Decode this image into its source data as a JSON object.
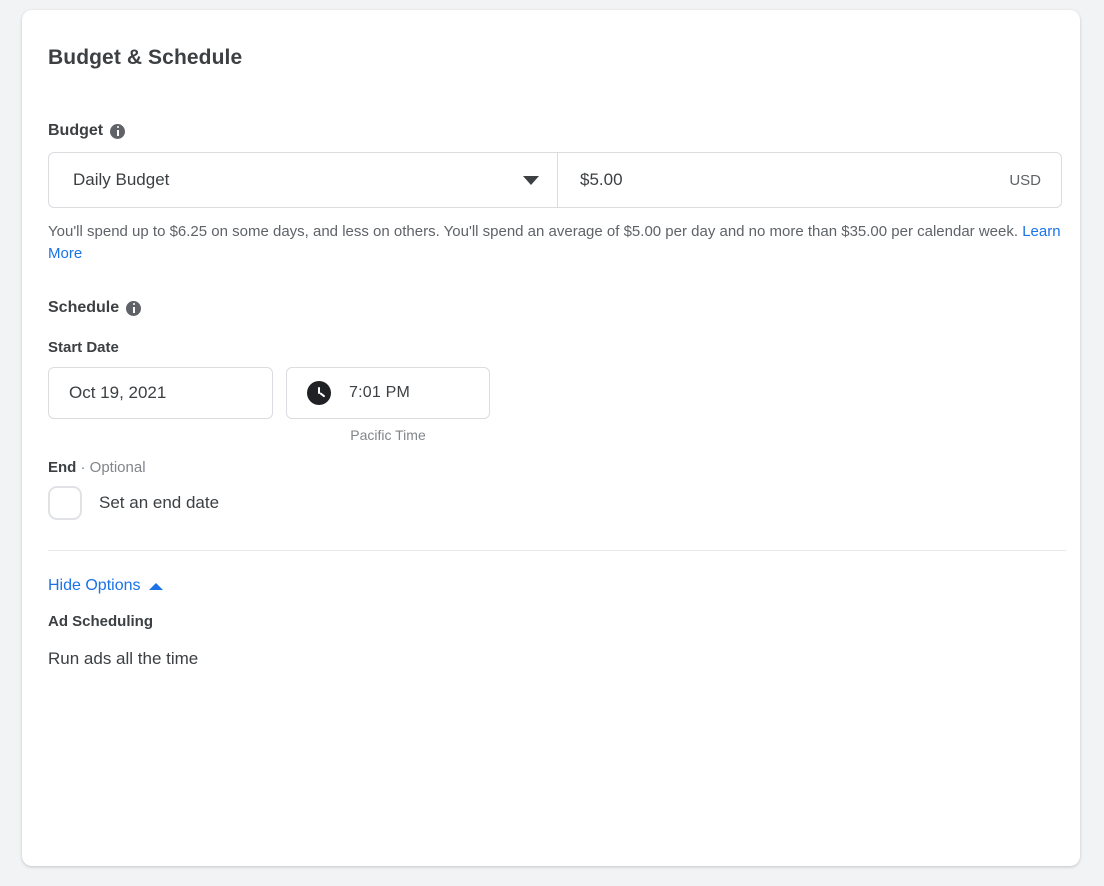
{
  "card": {
    "title": "Budget & Schedule"
  },
  "budget": {
    "label": "Budget",
    "info_icon": "info-icon",
    "type_value": "Daily Budget",
    "type_options": [
      "Daily Budget"
    ],
    "caret_icon": "chevron-down-icon",
    "amount_value": "$5.00",
    "currency": "USD",
    "help_text_before": "You'll spend up to $6.25 on some days, and less on others. You'll spend an average of $5.00 per day and no more than $35.00 per calendar week. ",
    "help_link": "Learn More"
  },
  "schedule": {
    "label": "Schedule",
    "info_icon": "info-icon",
    "start_date_label": "Start Date",
    "start_date_value": "Oct 19, 2021",
    "clock_icon": "clock-icon",
    "start_time_value": "7:01 PM",
    "timezone_caption": "Pacific Time",
    "end_label_strong": "End",
    "end_label_rest": " · Optional",
    "end_checkbox_label": "Set an end date",
    "end_checkbox_checked": false
  },
  "options": {
    "toggle_label": "Hide Options",
    "toggle_caret_icon": "caret-up-icon",
    "ad_scheduling_title": "Ad Scheduling",
    "ad_scheduling_value": "Run ads all the time"
  },
  "colors": {
    "link": "#1a73e8",
    "text_primary": "#3c4043",
    "text_secondary": "#5f6368",
    "border": "#dadce0",
    "page_bg": "#f1f3f4"
  }
}
